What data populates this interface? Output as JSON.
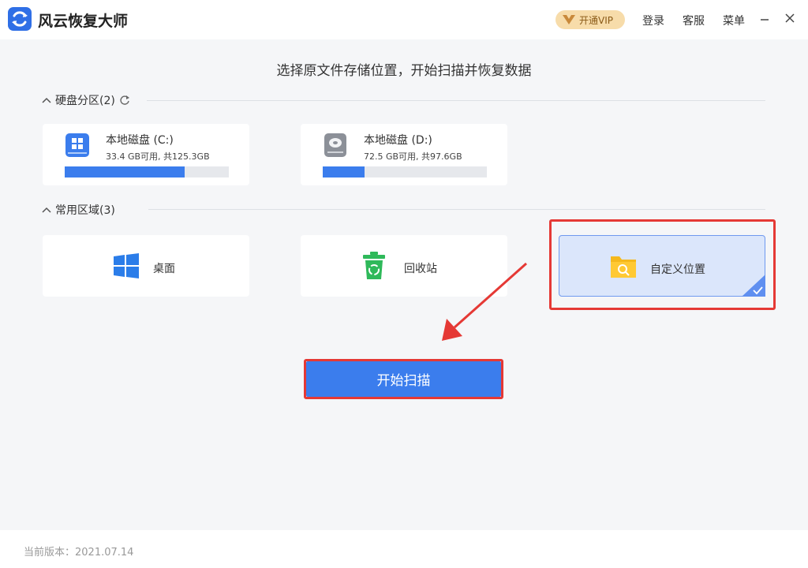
{
  "app": {
    "title": "风云恢复大师",
    "logo_icon": "app-logo-icon"
  },
  "titlebar": {
    "vip_label": "开通VIP",
    "login": "登录",
    "service": "客服",
    "menu": "菜单"
  },
  "heading": "选择原文件存储位置，开始扫描并恢复数据",
  "disks": {
    "title": "硬盘分区(2)",
    "items": [
      {
        "name": "本地磁盘 (C:)",
        "info": "33.4 GB可用, 共125.3GB",
        "used_fraction": 0.733,
        "icon": "windows-drive-icon"
      },
      {
        "name": "本地磁盘 (D:)",
        "info": "72.5 GB可用, 共97.6GB",
        "used_fraction": 0.257,
        "icon": "hard-drive-icon"
      }
    ]
  },
  "areas": {
    "title": "常用区域(3)",
    "items": [
      {
        "label": "桌面",
        "icon": "windows-logo-icon"
      },
      {
        "label": "回收站",
        "icon": "recycle-bin-icon"
      },
      {
        "label": "自定义位置",
        "icon": "folder-search-icon",
        "selected": true
      }
    ]
  },
  "scan_button": "开始扫描",
  "footer": {
    "version": "当前版本：2021.07.14"
  },
  "colors": {
    "accent": "#3b7ded",
    "highlight": "#e53935",
    "vip": "#f7dcaa",
    "selected_bg": "#dbe6fb"
  }
}
